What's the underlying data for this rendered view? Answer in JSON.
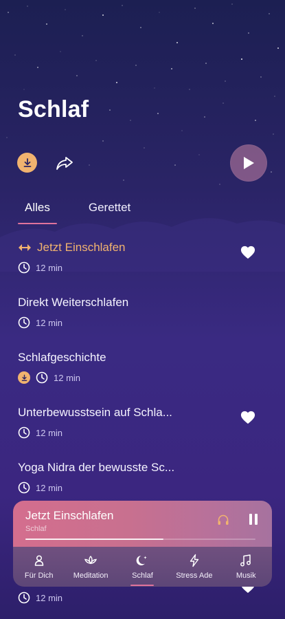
{
  "header": {
    "title": "Schlaf"
  },
  "actions": {
    "download": "download-icon",
    "share": "share-icon",
    "play": "play-icon"
  },
  "tabs": [
    {
      "label": "Alles",
      "active": true
    },
    {
      "label": "Gerettet",
      "active": false
    }
  ],
  "items": [
    {
      "title": "Jetzt Einschlafen",
      "duration": "12 min",
      "playing": true,
      "favorite": true,
      "downloaded": false
    },
    {
      "title": "Direkt Weiterschlafen",
      "duration": "12 min",
      "playing": false,
      "favorite": false,
      "downloaded": false
    },
    {
      "title": "Schlafgeschichte",
      "duration": "12 min",
      "playing": false,
      "favorite": false,
      "downloaded": true
    },
    {
      "title": "Unterbewusstsein auf Schla...",
      "duration": "12 min",
      "playing": false,
      "favorite": true,
      "downloaded": false
    },
    {
      "title": "Yoga Nidra der bewusste Sc...",
      "duration": "12 min",
      "playing": false,
      "favorite": false,
      "downloaded": false
    }
  ],
  "player": {
    "title": "Jetzt Einschlafen",
    "subtitle": "Schlaf",
    "progress": 0.6
  },
  "tabbar": [
    {
      "label": "Für Dich",
      "icon": "person-icon",
      "active": false
    },
    {
      "label": "Meditation",
      "icon": "lotus-icon",
      "active": false
    },
    {
      "label": "Schlaf",
      "icon": "moon-icon",
      "active": true
    },
    {
      "label": "Stress Ade",
      "icon": "lightning-icon",
      "active": false
    },
    {
      "label": "Musik",
      "icon": "music-icon",
      "active": false
    }
  ],
  "bottom_item": {
    "duration": "12 min"
  },
  "colors": {
    "accent": "#f1b36f",
    "pink": "#e0739c",
    "background": "#2e2470"
  }
}
